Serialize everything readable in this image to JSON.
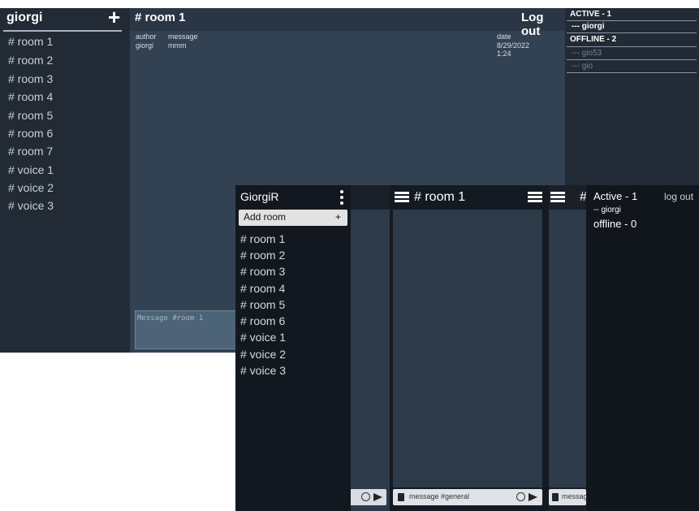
{
  "desktop": {
    "sidebar": {
      "username": "giorgi",
      "add_icon": "plus-icon",
      "rooms": [
        "# room 1",
        "# room 2",
        "# room 3",
        "# room 4",
        "# room 5",
        "# room 6",
        "# room 7",
        "# voice 1",
        "# voice 2",
        "# voice 3"
      ]
    },
    "main": {
      "room_title": "# room 1",
      "logout_label": "Log out",
      "columns": {
        "author": "author",
        "message": "message",
        "date": "date"
      },
      "messages": [
        {
          "author": "giorgi",
          "message": "mmm",
          "date": "8/29/2022",
          "time": "1:24"
        }
      ],
      "input_placeholder": "Message #room 1"
    },
    "members": {
      "active_heading": "ACTIVE - 1",
      "active_users": [
        "--- giorgi"
      ],
      "offline_heading": "OFFLINE - 2",
      "offline_users": [
        "--- gio53",
        "--- gio"
      ]
    }
  },
  "mobile": {
    "rooms_panel": {
      "username": "GiorgiR",
      "menu_icon": "kebab-menu-icon",
      "add_room_label": "Add room",
      "add_room_plus": "+",
      "rooms": [
        "# room 1",
        "# room 2",
        "# room 3",
        "# room 4",
        "# room 5",
        "# room 6",
        "# voice 1",
        "# voice 2",
        "# voice 3"
      ]
    },
    "chat": {
      "room_title": "# room 1",
      "input_placeholder": "message #general"
    },
    "members": {
      "partial_title": "# r",
      "partial_input": "messag",
      "active_heading": "Active - 1",
      "logout_label": "log out",
      "active_users": [
        "-- giorgi"
      ],
      "offline_heading": "offline - 0"
    }
  },
  "colors": {
    "desktop_sidebar": "#212a35",
    "desktop_main": "#334253",
    "input_bg": "#4d6378",
    "mobile_panel": "#131820",
    "mobile_chat": "#2c3a49"
  }
}
